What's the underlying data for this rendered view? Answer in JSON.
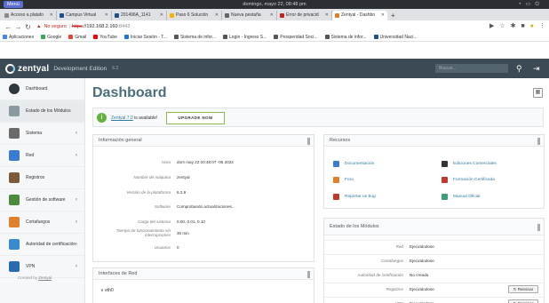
{
  "os": {
    "menu": "Menú",
    "clock": "domingo, mayo 22, 08:48 pm"
  },
  "tabs": [
    {
      "label": "Acceso a platafo",
      "color": "#8a8a8a"
    },
    {
      "label": "Campus Virtual",
      "color": "#1e4e8c"
    },
    {
      "label": "201496A_1141",
      "color": "#1e4e8c"
    },
    {
      "label": "Paso 6 Solución",
      "color": "#f4b400"
    },
    {
      "label": "Nueva pestaña",
      "color": "#666666"
    },
    {
      "label": "Error de privacid",
      "color": "#c5221f"
    },
    {
      "label": "Zentyal - Dashbo",
      "color": "#e37c2b",
      "active": true
    }
  ],
  "address": {
    "security_label": "No seguro",
    "scheme": "https",
    "host": "://192.168.2.160",
    "port": ":8443"
  },
  "bookmarks": [
    {
      "label": "Aplicaciones",
      "color": "#4285f4"
    },
    {
      "label": "Google",
      "color": "#34a853"
    },
    {
      "label": "Gmail",
      "color": "#ea4335"
    },
    {
      "label": "YouTube",
      "color": "#ff0000"
    },
    {
      "label": "Iniciar Sesión - T...",
      "color": "#1976d2"
    },
    {
      "label": "Sistema de infor...",
      "color": "#555555"
    },
    {
      "label": "Login - Ingreso S...",
      "color": "#555555"
    },
    {
      "label": "Prosperidad Soci...",
      "color": "#555555"
    },
    {
      "label": "Sistema de infor...",
      "color": "#555555"
    },
    {
      "label": "Universidad Naci...",
      "color": "#1e4e8c"
    }
  ],
  "header": {
    "brand": "zentyal",
    "edition": "Development Edition",
    "version": "6.2",
    "search_placeholder": "Buscar..."
  },
  "sidebar": {
    "items": [
      {
        "label": "Dashboard",
        "arrow": "",
        "color": "#2e3a40"
      },
      {
        "label": "Estado de los Módulos",
        "arrow": "",
        "color": "#8a9aa0",
        "active": true
      },
      {
        "label": "Sistema",
        "arrow": "‹",
        "color": "#6a6a6a"
      },
      {
        "label": "Red",
        "arrow": "‹",
        "color": "#3b7bd0"
      },
      {
        "label": "Registros",
        "arrow": "",
        "color": "#7a5a3a"
      },
      {
        "label": "Gestión de software",
        "arrow": "‹",
        "color": "#4c8a3c"
      },
      {
        "label": "Cortafuegos",
        "arrow": "‹",
        "color": "#e0802a"
      },
      {
        "label": "Autoridad de certificación",
        "arrow": "‹",
        "color": "#3a8ad0"
      },
      {
        "label": "VPN",
        "arrow": "‹",
        "color": "#2a6ab0"
      }
    ],
    "created_by": "Created by",
    "created_link": "Zentyal"
  },
  "main": {
    "title": "Dashboard",
    "notice_link": "Zentyal 7.0",
    "notice_text": "is available!",
    "upgrade_label": "UPGRADE NOW"
  },
  "info": {
    "title": "Información general",
    "rows": [
      {
        "key": "Hora",
        "value": "dom may 22 20:48:07 -05 2022"
      },
      {
        "key": "Nombre de máquina",
        "value": "zentyal"
      },
      {
        "key": "Versión de la plataforma",
        "value": "6.2.9"
      },
      {
        "key": "Software",
        "value": "Comprobando actualizaciones..."
      },
      {
        "key": "Carga del sistema",
        "value": "0.00, 0.01, 0.10"
      },
      {
        "key": "Tiempo de funcionamiento sin interrupciones",
        "value": "30 min"
      },
      {
        "key": "Usuarios",
        "value": "0"
      }
    ]
  },
  "resources": {
    "title": "Recursos",
    "items": [
      {
        "label": "Documentación",
        "color": "#3b7bd0"
      },
      {
        "label": "Ediciones Comerciales",
        "color": "#333333"
      },
      {
        "label": "Foro",
        "color": "#e0802a"
      },
      {
        "label": "Formación Certificada",
        "color": "#c0392b"
      },
      {
        "label": "Reportar un bug",
        "color": "#c0392b"
      },
      {
        "label": "Manual Oficial",
        "color": "#3aa07a"
      }
    ]
  },
  "modules": {
    "title": "Estado de los Módulos",
    "rows": [
      {
        "name": "Red",
        "status": "Ejecutándose",
        "button": ""
      },
      {
        "name": "Cortafuegos",
        "status": "Ejecutándose",
        "button": ""
      },
      {
        "name": "Autoridad de certificación",
        "status": "No creada",
        "button": ""
      },
      {
        "name": "Registros",
        "status": "Ejecutándose",
        "button": "Reiniciar"
      },
      {
        "name": "VPN",
        "status": "Ejecutándose",
        "button": "Reiniciar"
      }
    ]
  },
  "interfaces": {
    "title": "Interfaces de Red",
    "item": "eth0"
  }
}
